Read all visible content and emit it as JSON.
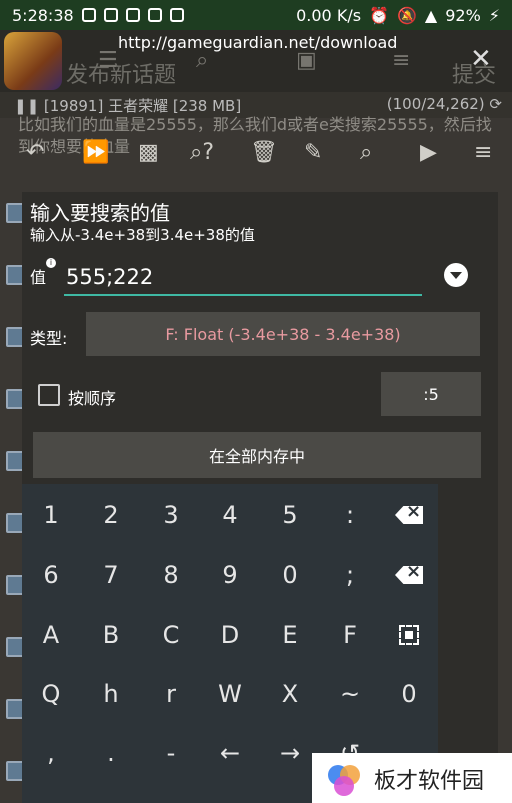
{
  "status": {
    "time": "5:28:38",
    "speed": "0.00 K/s",
    "battery": "92%"
  },
  "background": {
    "url": "http://gameguardian.net/download",
    "tab_label": "发布新话题",
    "submit_label": "提交",
    "process": "[19891] 王者荣耀 [238 MB]",
    "counter": "(100/24,262)",
    "text": "比如我们的血量是25555，那么我们d或者e类搜索25555，然后找到你想要的血量"
  },
  "dialog": {
    "title": "输入要搜索的值",
    "subtitle": "输入从-3.4e+38到3.4e+38的值",
    "value_label": "值",
    "value": "555;222",
    "type_label": "类型:",
    "type_value": "F: Float (-3.4e+38 - 3.4e+38)",
    "order_label": "按顺序",
    "order_value": ":5",
    "memory_label": "在全部内存中"
  },
  "keyboard": {
    "rows": [
      [
        "1",
        "2",
        "3",
        "4",
        "5",
        ":",
        "backspace"
      ],
      [
        "6",
        "7",
        "8",
        "9",
        "0",
        ";",
        "clear"
      ],
      [
        "A",
        "B",
        "C",
        "D",
        "E",
        "F",
        "select"
      ],
      [
        "Q",
        "h",
        "r",
        "W",
        "X",
        "~",
        "0"
      ],
      [
        ",",
        ".",
        "-",
        "←",
        "→",
        "history",
        "v"
      ]
    ]
  },
  "watermark": {
    "text": "板才软件园"
  }
}
